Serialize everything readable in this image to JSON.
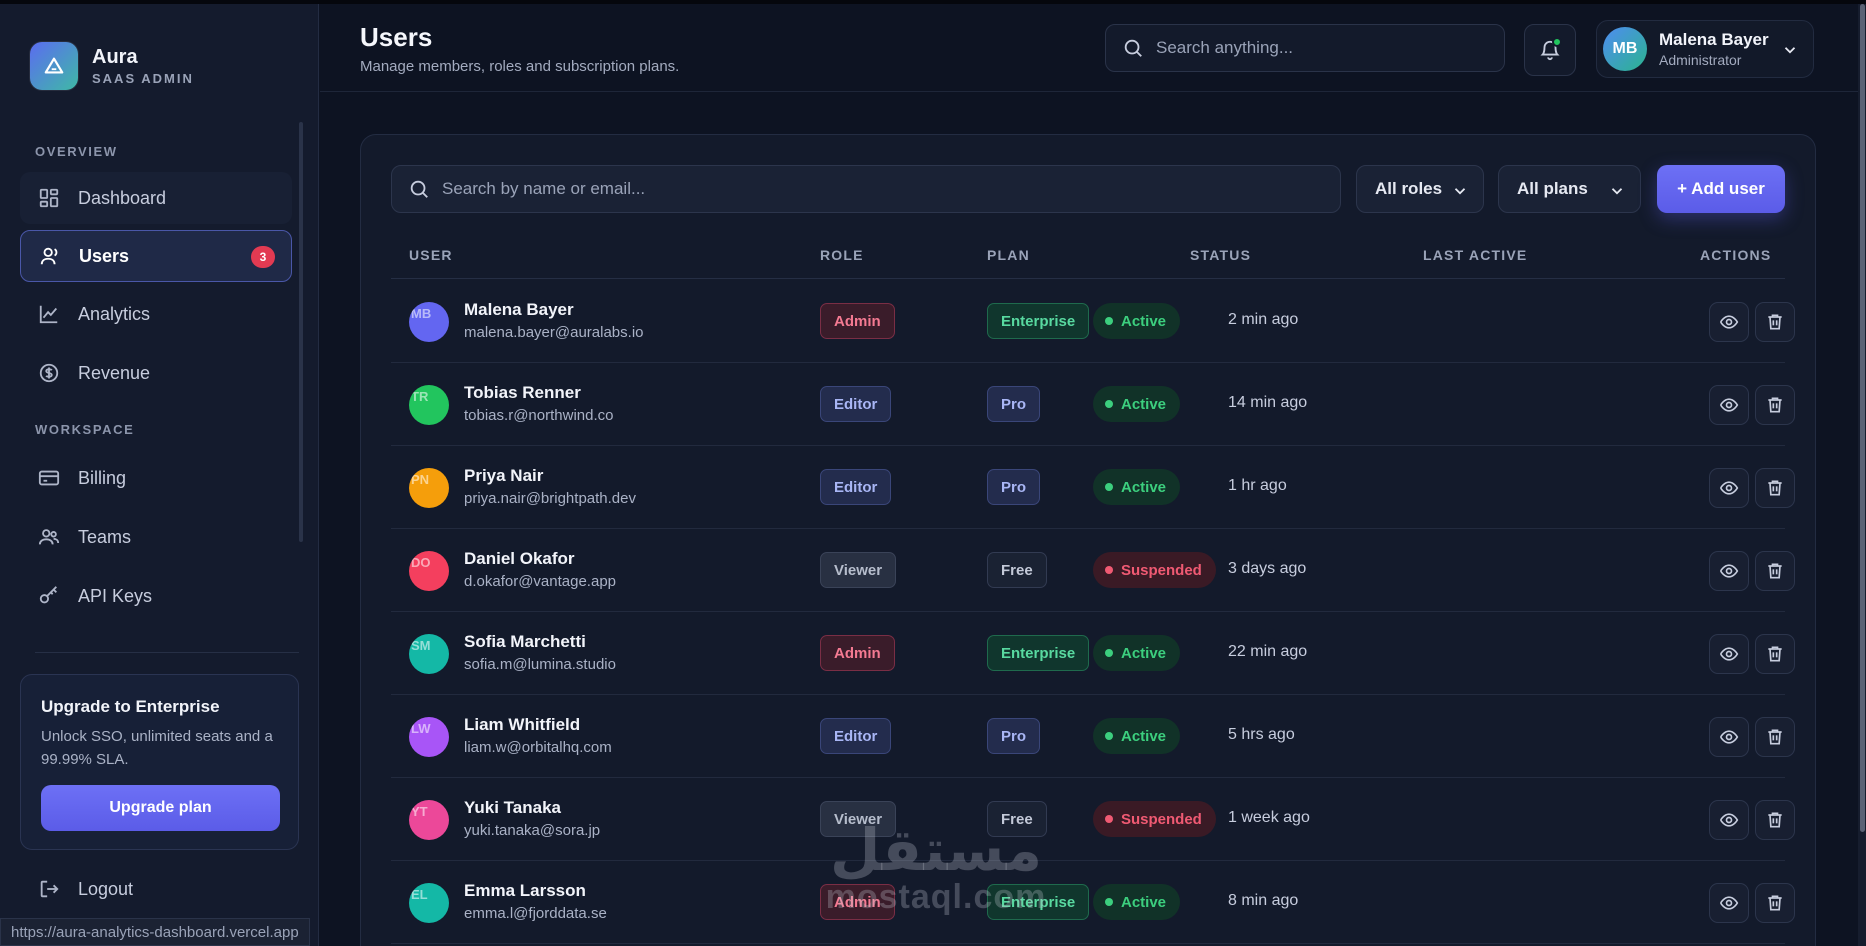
{
  "brand": {
    "name": "Aura",
    "subtitle": "SAAS ADMIN"
  },
  "sidebar": {
    "overview_label": "OVERVIEW",
    "workspace_label": "WORKSPACE",
    "items": [
      {
        "label": "Dashboard",
        "icon": "grid-icon"
      },
      {
        "label": "Users",
        "icon": "users-icon",
        "badge": "3",
        "active": true
      },
      {
        "label": "Analytics",
        "icon": "chart-line-icon"
      },
      {
        "label": "Revenue",
        "icon": "dollar-circle-icon"
      },
      {
        "label": "Billing",
        "icon": "credit-card-icon"
      },
      {
        "label": "Teams",
        "icon": "team-icon"
      },
      {
        "label": "API Keys",
        "icon": "key-icon"
      }
    ],
    "upgrade": {
      "title": "Upgrade to Enterprise",
      "text": "Unlock SSO, unlimited seats and a 99.99% SLA.",
      "button": "Upgrade plan"
    },
    "logout": "Logout"
  },
  "status_url": "https://aura-analytics-dashboard.vercel.app",
  "header": {
    "title": "Users",
    "subtitle": "Manage members, roles and subscription plans.",
    "search_placeholder": "Search anything...",
    "profile": {
      "initials": "MB",
      "name": "Malena Bayer",
      "role": "Administrator"
    }
  },
  "toolbar": {
    "search_placeholder": "Search by name or email...",
    "roles_filter": "All roles",
    "plans_filter": "All plans",
    "add_button": "+ Add user"
  },
  "table": {
    "columns": [
      "USER",
      "ROLE",
      "PLAN",
      "STATUS",
      "LAST ACTIVE",
      "ACTIONS"
    ],
    "rows": [
      {
        "initials": "MB",
        "name": "Malena Bayer",
        "email": "malena.bayer@auralabs.io",
        "role": "Admin",
        "plan": "Enterprise",
        "status": "Active",
        "last_active": "2 min ago",
        "avatar_color": "#6366f1"
      },
      {
        "initials": "TR",
        "name": "Tobias Renner",
        "email": "tobias.r@northwind.co",
        "role": "Editor",
        "plan": "Pro",
        "status": "Active",
        "last_active": "14 min ago",
        "avatar_color": "#22c55e"
      },
      {
        "initials": "PN",
        "name": "Priya Nair",
        "email": "priya.nair@brightpath.dev",
        "role": "Editor",
        "plan": "Pro",
        "status": "Active",
        "last_active": "1 hr ago",
        "avatar_color": "#f59e0b"
      },
      {
        "initials": "DO",
        "name": "Daniel Okafor",
        "email": "d.okafor@vantage.app",
        "role": "Viewer",
        "plan": "Free",
        "status": "Suspended",
        "last_active": "3 days ago",
        "avatar_color": "#f43f5e"
      },
      {
        "initials": "SM",
        "name": "Sofia Marchetti",
        "email": "sofia.m@lumina.studio",
        "role": "Admin",
        "plan": "Enterprise",
        "status": "Active",
        "last_active": "22 min ago",
        "avatar_color": "#14b8a6"
      },
      {
        "initials": "LW",
        "name": "Liam Whitfield",
        "email": "liam.w@orbitalhq.com",
        "role": "Editor",
        "plan": "Pro",
        "status": "Active",
        "last_active": "5 hrs ago",
        "avatar_color": "#a855f7"
      },
      {
        "initials": "YT",
        "name": "Yuki Tanaka",
        "email": "yuki.tanaka@sora.jp",
        "role": "Viewer",
        "plan": "Free",
        "status": "Suspended",
        "last_active": "1 week ago",
        "avatar_color": "#ec4899"
      },
      {
        "initials": "EL",
        "name": "Emma Larsson",
        "email": "emma.l@fjorddata.se",
        "role": "Admin",
        "plan": "Enterprise",
        "status": "Active",
        "last_active": "8 min ago",
        "avatar_color": "#14b8a6"
      }
    ]
  },
  "watermark": {
    "arabic": "مستقل",
    "latin": "mostaql.com"
  }
}
